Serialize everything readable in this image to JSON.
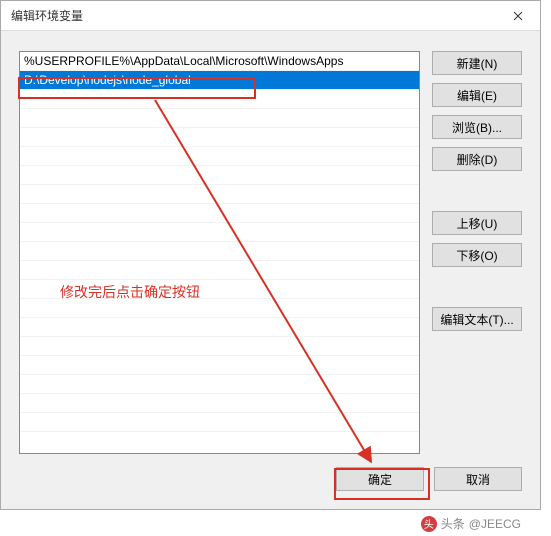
{
  "title": "编辑环境变量",
  "list": {
    "items": [
      "%USERPROFILE%\\AppData\\Local\\Microsoft\\WindowsApps",
      "D:\\Develop\\nodejs\\node_global"
    ],
    "selected_index": 1
  },
  "buttons": {
    "new": "新建(N)",
    "edit": "编辑(E)",
    "browse": "浏览(B)...",
    "delete": "删除(D)",
    "move_up": "上移(U)",
    "move_down": "下移(O)",
    "edit_text": "编辑文本(T)...",
    "ok": "确定",
    "cancel": "取消"
  },
  "annotation": {
    "text": "修改完后点击确定按钮"
  },
  "watermark": {
    "source": "头条",
    "handle": "@JEECG"
  }
}
